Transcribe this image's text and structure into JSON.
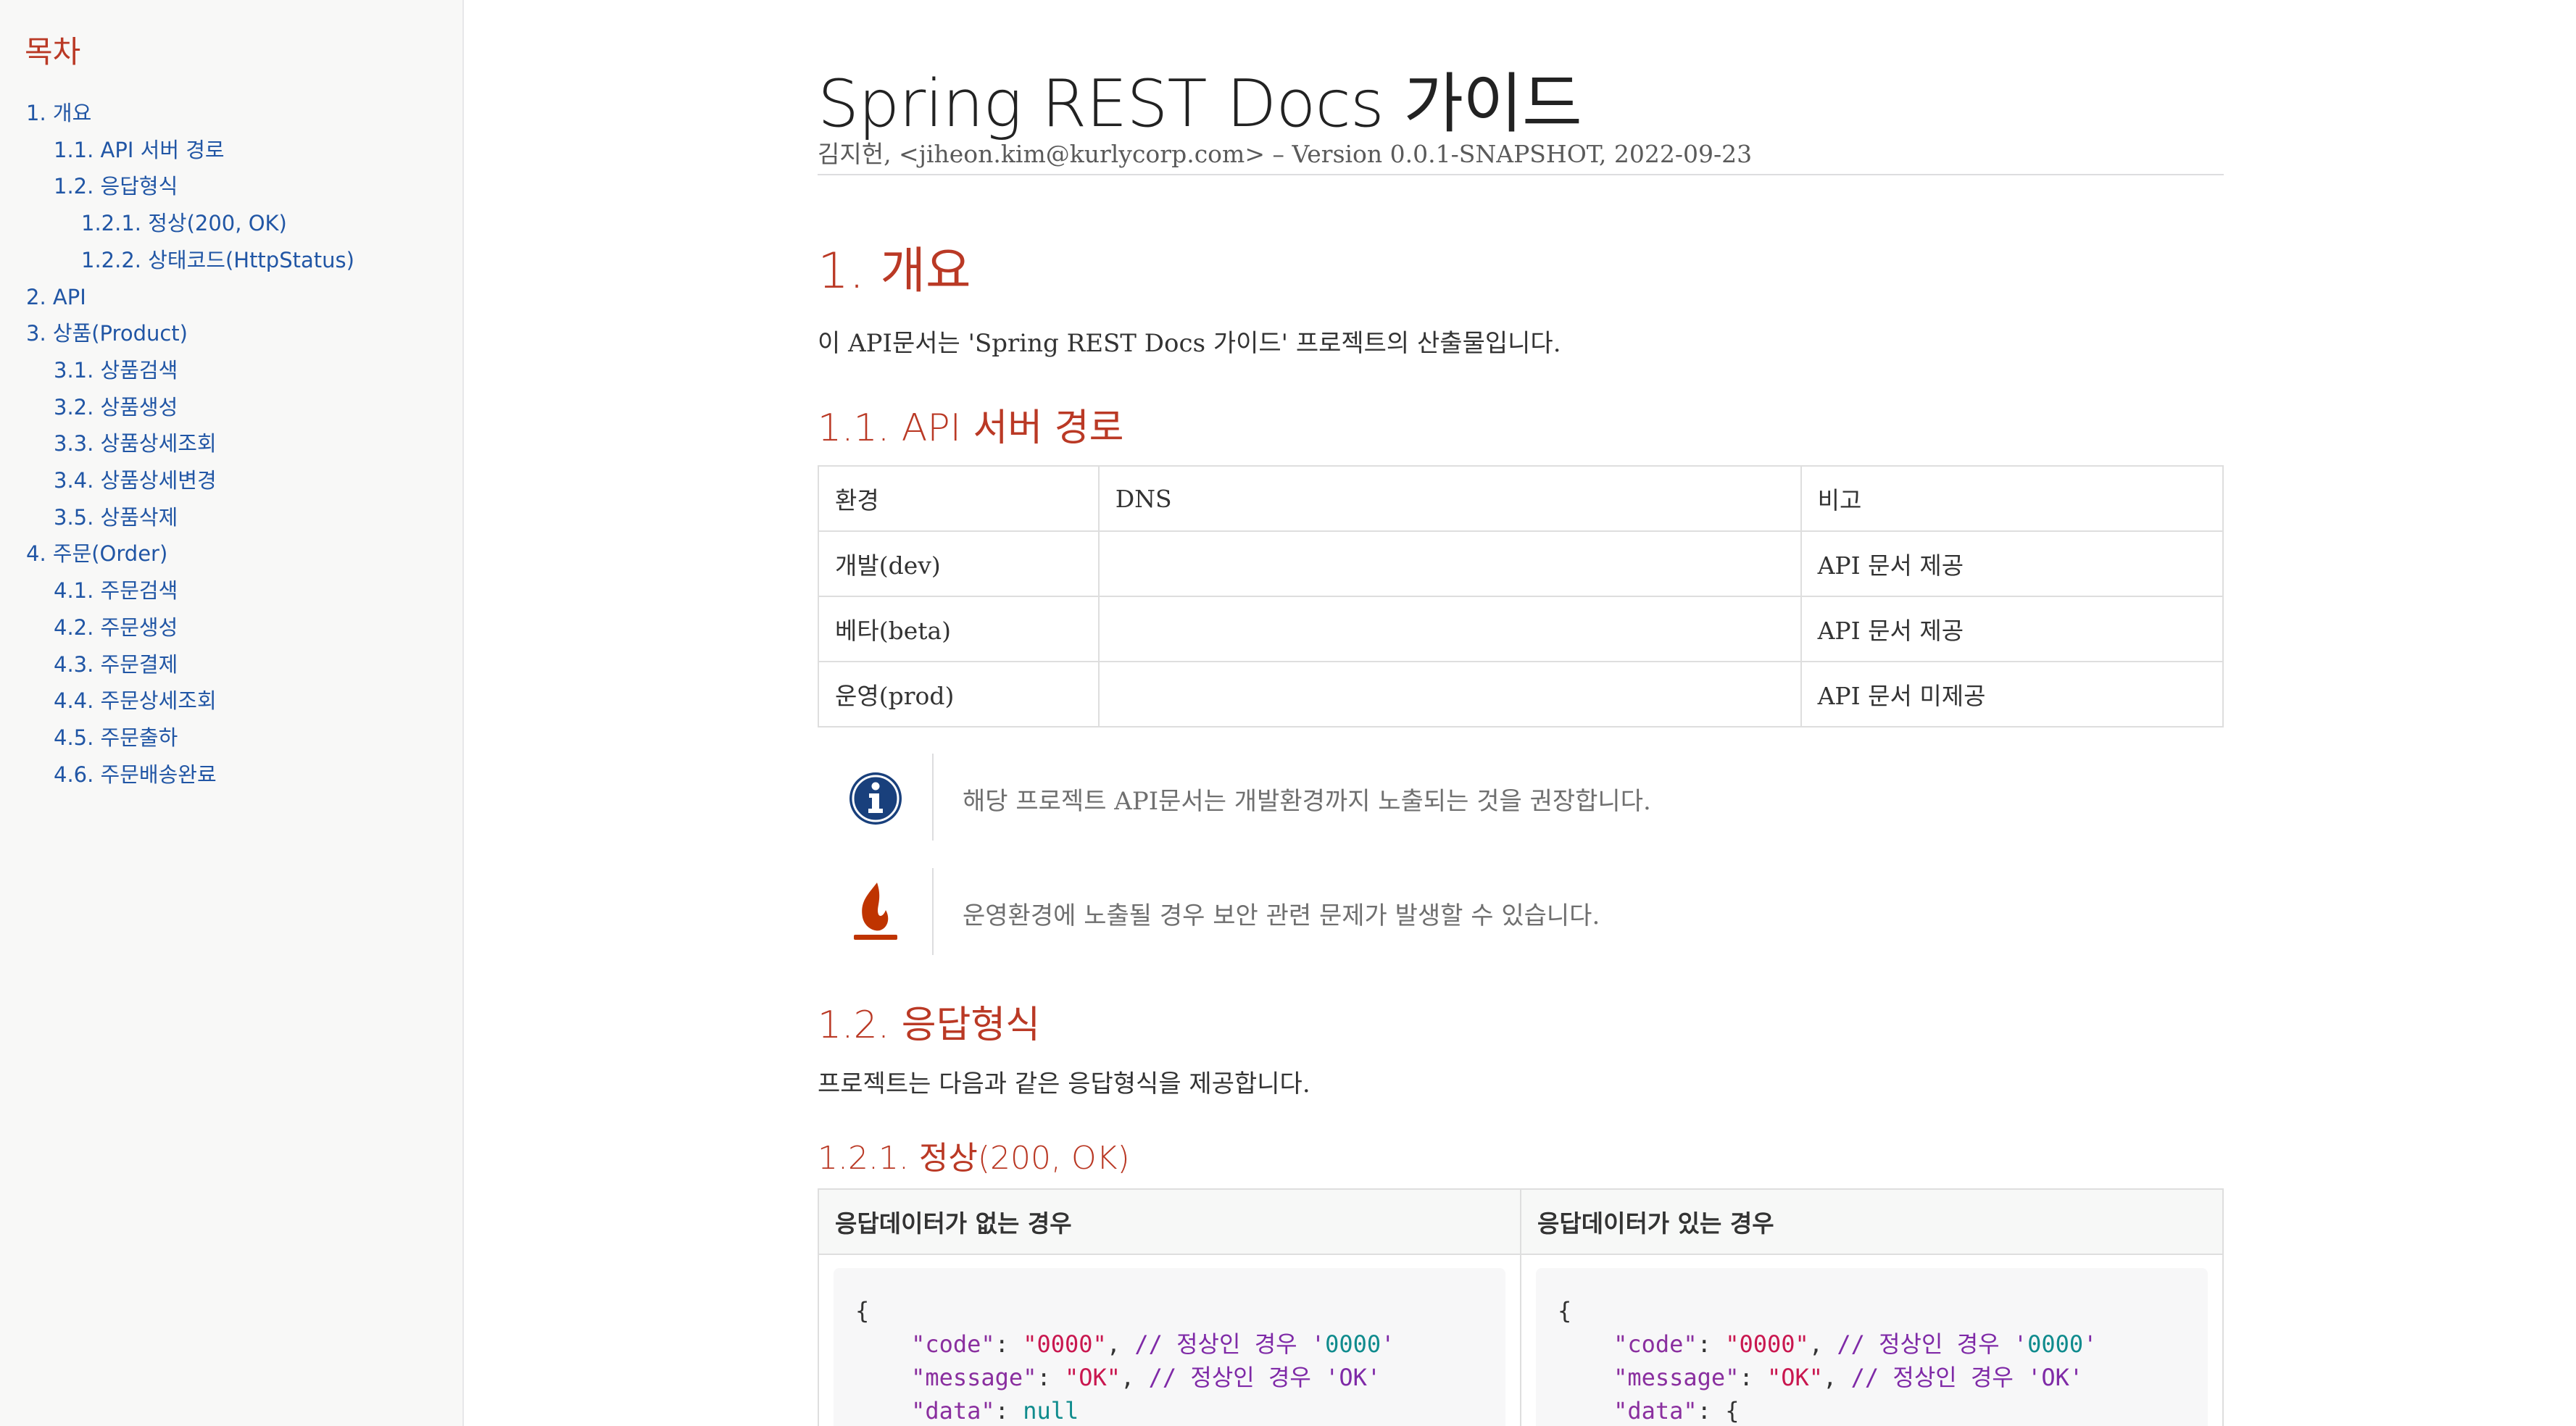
{
  "toc": {
    "title": "목차",
    "items": [
      {
        "label": "1. 개요",
        "level": 1
      },
      {
        "label": "1.1. API 서버 경로",
        "level": 2
      },
      {
        "label": "1.2. 응답형식",
        "level": 2
      },
      {
        "label": "1.2.1. 정상(200, OK)",
        "level": 3
      },
      {
        "label": "1.2.2. 상태코드(HttpStatus)",
        "level": 3
      },
      {
        "label": "2. API",
        "level": 1
      },
      {
        "label": "3. 상품(Product)",
        "level": 1
      },
      {
        "label": "3.1. 상품검색",
        "level": 2
      },
      {
        "label": "3.2. 상품생성",
        "level": 2
      },
      {
        "label": "3.3. 상품상세조회",
        "level": 2
      },
      {
        "label": "3.4. 상품상세변경",
        "level": 2
      },
      {
        "label": "3.5. 상품삭제",
        "level": 2
      },
      {
        "label": "4. 주문(Order)",
        "level": 1
      },
      {
        "label": "4.1. 주문검색",
        "level": 2
      },
      {
        "label": "4.2. 주문생성",
        "level": 2
      },
      {
        "label": "4.3. 주문결제",
        "level": 2
      },
      {
        "label": "4.4. 주문상세조회",
        "level": 2
      },
      {
        "label": "4.5. 주문출하",
        "level": 2
      },
      {
        "label": "4.6. 주문배송완료",
        "level": 2
      }
    ]
  },
  "header": {
    "title": "Spring REST Docs 가이드",
    "details": "김지헌, <jiheon.kim@kurlycorp.com> – Version 0.0.1-SNAPSHOT, 2022-09-23"
  },
  "section_overview": {
    "heading": "1. 개요",
    "intro": "이 API문서는 'Spring REST Docs 가이드' 프로젝트의 산출물입니다."
  },
  "section_server": {
    "heading": "1.1. API 서버 경로",
    "table": {
      "header": [
        "환경",
        "DNS",
        "비고"
      ],
      "rows": [
        [
          "개발(dev)",
          "",
          "API 문서 제공"
        ],
        [
          "베타(beta)",
          "",
          "API 문서 제공"
        ],
        [
          "운영(prod)",
          "",
          "API 문서 미제공"
        ]
      ]
    },
    "note": "해당 프로젝트 API문서는 개발환경까지 노출되는 것을 권장합니다.",
    "caution": "운영환경에 노출될 경우 보안 관련 문제가 발생할 수 있습니다."
  },
  "section_response": {
    "heading": "1.2. 응답형식",
    "intro": "프로젝트는 다음과 같은 응답형식을 제공합니다.",
    "sub_heading": "1.2.1. 정상(200, OK)",
    "columns": [
      "응답데이터가 없는 경우",
      "응답데이터가 있는 경우"
    ],
    "code_no_data": {
      "open": "{",
      "code_key": "\"code\"",
      "code_val": "\"0000\"",
      "code_comment": "// 정상인 경우 '",
      "code_comment_num": "0000",
      "code_comment_end": "'",
      "msg_key": "\"message\"",
      "msg_val": "\"OK\"",
      "msg_comment": "// 정상인 경우 'OK'",
      "data_key": "\"data\"",
      "data_val": "null"
    },
    "code_with_data": {
      "open": "{",
      "code_key": "\"code\"",
      "code_val": "\"0000\"",
      "code_comment": "// 정상인 경우 '",
      "code_comment_num": "0000",
      "code_comment_end": "'",
      "msg_key": "\"message\"",
      "msg_val": "\"OK\"",
      "msg_comment": "// 정상인 경우 'OK'",
      "data_key": "\"data\"",
      "data_val": "{"
    }
  },
  "colors": {
    "link": "#2156a5",
    "heading": "#ba3925",
    "note_icon": "#19407c",
    "caution_icon": "#bf3400"
  },
  "icons": {
    "note": "info-circle-icon",
    "caution": "flame-icon"
  }
}
